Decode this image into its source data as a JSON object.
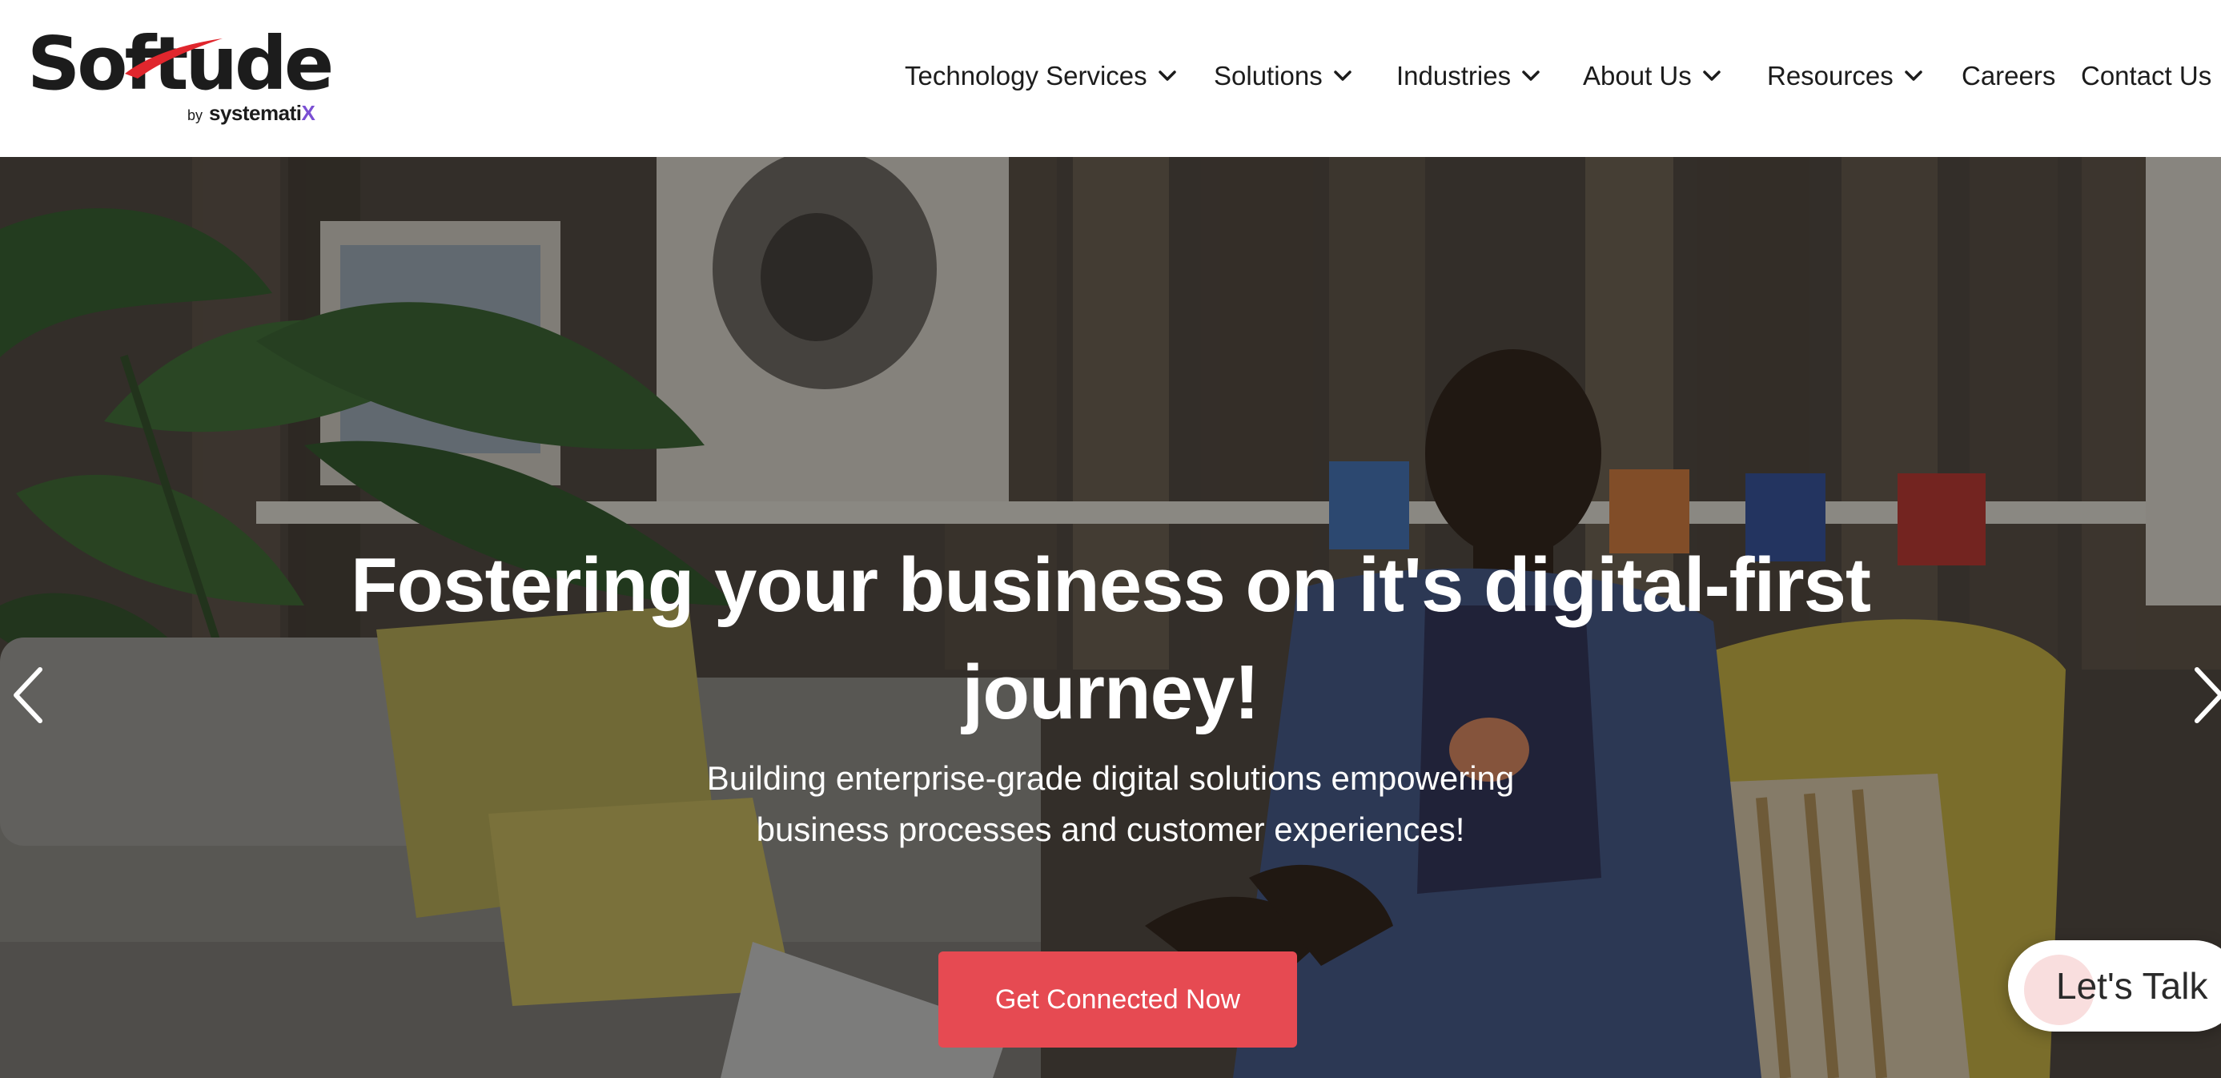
{
  "header": {
    "logo": {
      "wordmark": "Softude",
      "byline_prefix": "by",
      "byline_brand": "systemati",
      "byline_brand_suffix": "X",
      "accent_color": "#e0262d"
    },
    "nav": [
      {
        "label": "Technology Services",
        "has_dropdown": true,
        "icon": "chevron-down-icon"
      },
      {
        "label": "Solutions",
        "has_dropdown": true,
        "icon": "chevron-down-icon"
      },
      {
        "label": "Industries",
        "has_dropdown": true,
        "icon": "chevron-down-icon"
      },
      {
        "label": "About Us",
        "has_dropdown": true,
        "icon": "chevron-down-icon"
      },
      {
        "label": "Resources",
        "has_dropdown": true,
        "icon": "chevron-down-icon"
      },
      {
        "label": "Careers",
        "has_dropdown": false
      },
      {
        "label": "Contact Us",
        "has_dropdown": false
      }
    ]
  },
  "hero": {
    "title_line1": "Fostering your business on it's digital-first",
    "title_line2": "journey!",
    "subtitle_line1": "Building enterprise-grade digital solutions empowering",
    "subtitle_line2": "business processes and customer experiences!",
    "cta_label": "Get Connected Now",
    "cta_color": "#e64a52",
    "prev_icon": "chevron-left-icon",
    "next_icon": "chevron-right-icon"
  },
  "chat_widget": {
    "label": "Let's Talk"
  }
}
